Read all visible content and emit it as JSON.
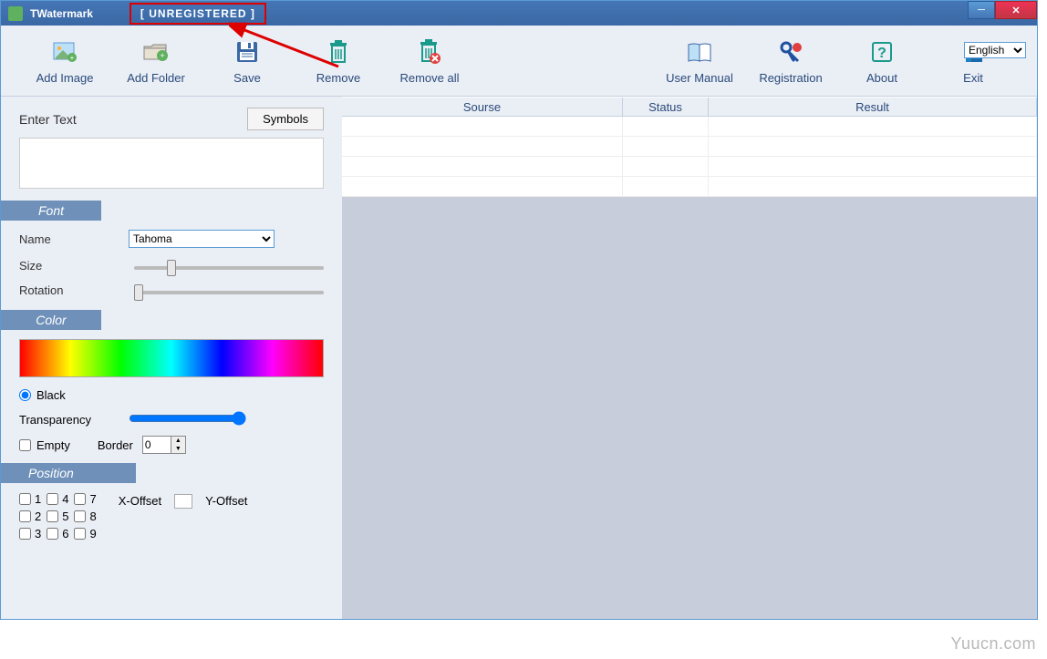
{
  "titlebar": {
    "app_name": "TWatermark",
    "badge": "[ UNREGISTERED ]"
  },
  "toolbar": {
    "add_image": "Add Image",
    "add_folder": "Add Folder",
    "save": "Save",
    "remove": "Remove",
    "remove_all": "Remove all",
    "user_manual": "User Manual",
    "registration": "Registration",
    "about": "About",
    "exit": "Exit",
    "language": "English"
  },
  "text_panel": {
    "enter_text_label": "Enter Text",
    "symbols_btn": "Symbols",
    "text_value": ""
  },
  "font": {
    "header": "Font",
    "name_label": "Name",
    "name_value": "Tahoma",
    "size_label": "Size",
    "size_value": 18,
    "rotation_label": "Rotation",
    "rotation_value": 0
  },
  "color": {
    "header": "Color",
    "black_label": "Black",
    "black_checked": true,
    "transparency_label": "Transparency",
    "transparency_value": 100,
    "empty_label": "Empty",
    "empty_checked": false,
    "border_label": "Border",
    "border_value": "0"
  },
  "position": {
    "header": "Position",
    "cells": [
      "1",
      "2",
      "3",
      "4",
      "5",
      "6",
      "7",
      "8",
      "9"
    ],
    "x_offset_label": "X-Offset",
    "y_offset_label": "Y-Offset"
  },
  "table": {
    "col_source": "Sourse",
    "col_status": "Status",
    "col_result": "Result"
  },
  "watermark_text": "Yuucn.com"
}
